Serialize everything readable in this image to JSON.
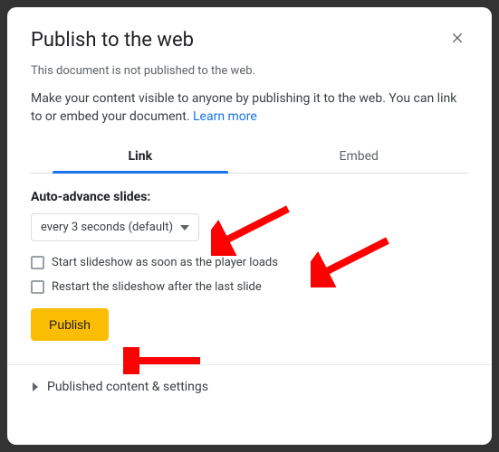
{
  "dialog": {
    "title": "Publish to the web",
    "status": "This document is not published to the web.",
    "description": "Make your content visible to anyone by publishing it to the web. You can link to or embed your document. ",
    "learnMore": "Learn more"
  },
  "tabs": {
    "link": "Link",
    "embed": "Embed"
  },
  "form": {
    "autoAdvanceLabel": "Auto-advance slides:",
    "autoAdvanceValue": "every 3 seconds (default)",
    "startOnLoad": "Start slideshow as soon as the player loads",
    "restart": "Restart the slideshow after the last slide",
    "publishButton": "Publish"
  },
  "footer": {
    "expand": "Published content & settings"
  },
  "colors": {
    "arrow": "#ff0000"
  }
}
